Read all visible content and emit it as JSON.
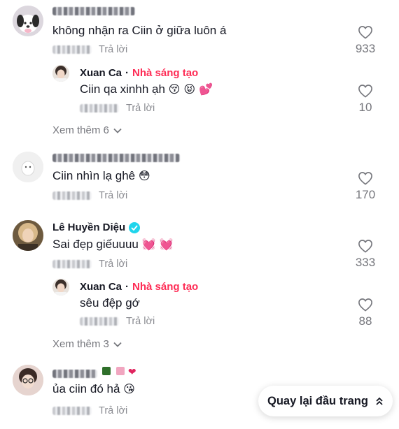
{
  "comments": [
    {
      "text": "không nhận ra Ciin ở giữa luôn á",
      "reply_label": "Trả lời",
      "likes": "933",
      "reply": {
        "username": "Xuan Ca",
        "separator": "·",
        "badge": "Nhà sáng tạo",
        "text": "Ciin qa xinhh ạh",
        "emojis": "😚 😝 💕",
        "reply_label": "Trả lời",
        "likes": "10"
      },
      "view_more": "Xem thêm 6"
    },
    {
      "text": "Ciin nhìn lạ ghê",
      "emojis": "😳",
      "reply_label": "Trả lời",
      "likes": "170"
    },
    {
      "username": "Lê Huyền Diệu",
      "text": "Sai đẹp giếuuuu",
      "emojis": "💓 💓",
      "reply_label": "Trả lời",
      "likes": "333",
      "reply": {
        "username": "Xuan Ca",
        "separator": "·",
        "badge": "Nhà sáng tạo",
        "text": "sêu đệp gớ",
        "reply_label": "Trả lời",
        "likes": "88"
      },
      "view_more": "Xem thêm 3"
    },
    {
      "text": "ủa ciin đó hả",
      "emojis": "😘",
      "reply_label": "Trả lời"
    }
  ],
  "back_to_top": "Quay lại đầu trang",
  "colors": {
    "creator_badge": "#fe2c55",
    "verified": "#20d5ec",
    "muted": "#8a8b91"
  }
}
